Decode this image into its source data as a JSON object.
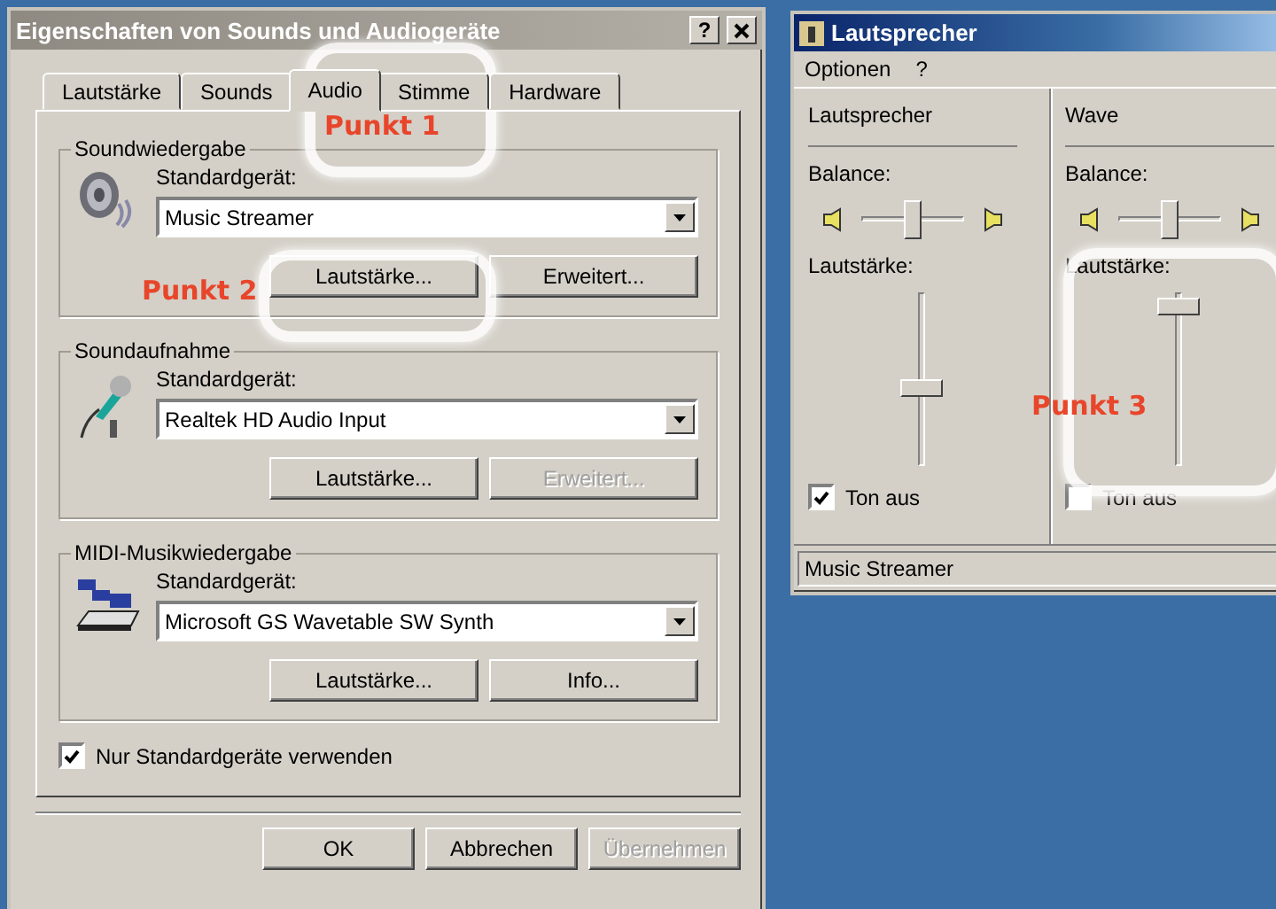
{
  "properties_window": {
    "title": "Eigenschaften von Sounds und Audiogeräte",
    "help_button": "?",
    "tabs": [
      {
        "label": "Lautstärke",
        "selected": false
      },
      {
        "label": "Sounds",
        "selected": false
      },
      {
        "label": "Audio",
        "selected": true
      },
      {
        "label": "Stimme",
        "selected": false
      },
      {
        "label": "Hardware",
        "selected": false
      }
    ],
    "groups": [
      {
        "kind": "speaker",
        "title": "Soundwiedergabe",
        "device_label": "Standardgerät:",
        "device": "Music Streamer",
        "buttons": [
          {
            "label": "Lautstärke...",
            "disabled": false
          },
          {
            "label": "Erweitert...",
            "disabled": false
          }
        ]
      },
      {
        "kind": "microphone",
        "title": "Soundaufnahme",
        "device_label": "Standardgerät:",
        "device": "Realtek HD Audio Input",
        "buttons": [
          {
            "label": "Lautstärke...",
            "disabled": false
          },
          {
            "label": "Erweitert...",
            "disabled": true
          }
        ]
      },
      {
        "kind": "midi",
        "title": "MIDI-Musikwiedergabe",
        "device_label": "Standardgerät:",
        "device": "Microsoft GS Wavetable SW Synth",
        "buttons": [
          {
            "label": "Lautstärke...",
            "disabled": false
          },
          {
            "label": "Info...",
            "disabled": false
          }
        ]
      }
    ],
    "option": {
      "label": "Nur Standardgeräte verwenden",
      "checked": true
    },
    "buttons": [
      {
        "label": "OK",
        "disabled": false
      },
      {
        "label": "Abbrechen",
        "disabled": false
      },
      {
        "label": "Übernehmen",
        "disabled": true
      }
    ]
  },
  "mixer_window": {
    "title": "Lautsprecher",
    "menu": [
      "Optionen",
      "?"
    ],
    "channels": [
      {
        "name": "Lautsprecher",
        "balance_label": "Balance:",
        "balance": {
          "level": 0.5
        },
        "volume_label": "Lautstärke:",
        "volume": {
          "level": 0.45
        },
        "mute_label": "Ton aus",
        "muted": true
      },
      {
        "name": "Wave",
        "balance_label": "Balance:",
        "balance": {
          "level": 0.5
        },
        "volume_label": "Lautstärke:",
        "volume": {
          "level": 0.97
        },
        "mute_label": "Ton aus",
        "muted": false
      }
    ],
    "status": "Music Streamer"
  },
  "annotations": [
    {
      "label": "Punkt 1"
    },
    {
      "label": "Punkt 2"
    },
    {
      "label": "Punkt 3"
    }
  ]
}
